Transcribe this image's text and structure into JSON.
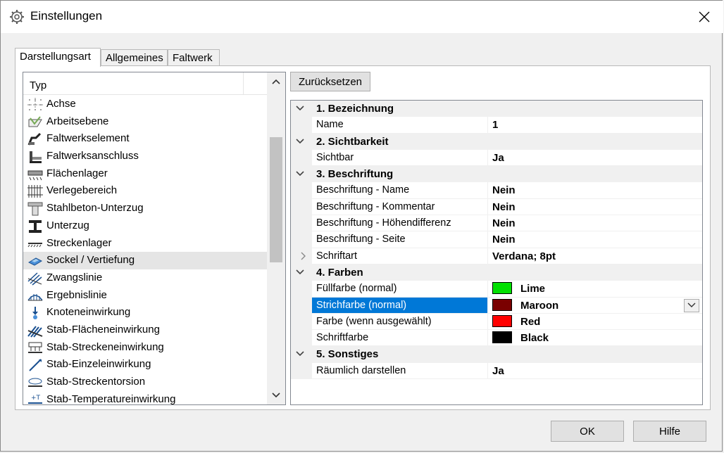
{
  "window": {
    "title": "Einstellungen"
  },
  "tabs": [
    {
      "label": "Darstellungsart",
      "active": true
    },
    {
      "label": "Allgemeines",
      "active": false
    },
    {
      "label": "Faltwerk",
      "active": false
    }
  ],
  "list": {
    "header": "Typ",
    "items": [
      {
        "label": "Achse",
        "icon": "axis-icon"
      },
      {
        "label": "Arbeitsebene",
        "icon": "work-plane-icon"
      },
      {
        "label": "Faltwerkselement",
        "icon": "folded-plate-element-icon"
      },
      {
        "label": "Faltwerksanschluss",
        "icon": "folded-plate-connection-icon"
      },
      {
        "label": "Flächenlager",
        "icon": "area-support-icon"
      },
      {
        "label": "Verlegebereich",
        "icon": "laying-area-icon"
      },
      {
        "label": "Stahlbeton-Unterzug",
        "icon": "rc-beam-icon"
      },
      {
        "label": "Unterzug",
        "icon": "beam-icon"
      },
      {
        "label": "Streckenlager",
        "icon": "line-support-icon"
      },
      {
        "label": "Sockel / Vertiefung",
        "icon": "pedestal-icon",
        "selected": true
      },
      {
        "label": "Zwangslinie",
        "icon": "constraint-line-icon"
      },
      {
        "label": "Ergebnislinie",
        "icon": "result-line-icon"
      },
      {
        "label": "Knoteneinwirkung",
        "icon": "node-load-icon"
      },
      {
        "label": "Stab-Flächeneinwirkung",
        "icon": "member-area-load-icon"
      },
      {
        "label": "Stab-Streckeneinwirkung",
        "icon": "member-line-load-icon"
      },
      {
        "label": "Stab-Einzeleinwirkung",
        "icon": "member-point-load-icon"
      },
      {
        "label": "Stab-Streckentorsion",
        "icon": "member-torsion-icon"
      },
      {
        "label": "Stab-Temperatureinwirkung",
        "icon": "member-temperature-icon"
      }
    ]
  },
  "reset_button": "Zurücksetzen",
  "properties": [
    {
      "type": "category",
      "label": "1. Bezeichnung"
    },
    {
      "type": "prop",
      "name": "Name",
      "value": "1"
    },
    {
      "type": "category",
      "label": "2. Sichtbarkeit"
    },
    {
      "type": "prop",
      "name": "Sichtbar",
      "value": "Ja"
    },
    {
      "type": "category",
      "label": "3. Beschriftung"
    },
    {
      "type": "prop",
      "name": "Beschriftung - Name",
      "value": "Nein"
    },
    {
      "type": "prop",
      "name": "Beschriftung - Kommentar",
      "value": "Nein"
    },
    {
      "type": "prop",
      "name": "Beschriftung - Höhendifferenz",
      "value": "Nein"
    },
    {
      "type": "prop",
      "name": "Beschriftung - Seite",
      "value": "Nein"
    },
    {
      "type": "prop",
      "name": "Schriftart",
      "value": "Verdana; 8pt",
      "expandable": true
    },
    {
      "type": "category",
      "label": "4. Farben"
    },
    {
      "type": "prop",
      "name": "Füllfarbe (normal)",
      "value": "Lime",
      "color": "#00e000"
    },
    {
      "type": "prop",
      "name": "Strichfarbe (normal)",
      "value": "Maroon",
      "color": "#7a0000",
      "selected": true
    },
    {
      "type": "prop",
      "name": "Farbe (wenn ausgewählt)",
      "value": "Red",
      "color": "#ff0000"
    },
    {
      "type": "prop",
      "name": "Schriftfarbe",
      "value": "Black",
      "color": "#000000"
    },
    {
      "type": "category",
      "label": "5. Sonstiges"
    },
    {
      "type": "prop",
      "name": "Räumlich darstellen",
      "value": "Ja"
    }
  ],
  "buttons": {
    "ok": "OK",
    "help": "Hilfe"
  },
  "colors": {
    "selection": "#0078d7",
    "accent_text": "#ffffff"
  }
}
